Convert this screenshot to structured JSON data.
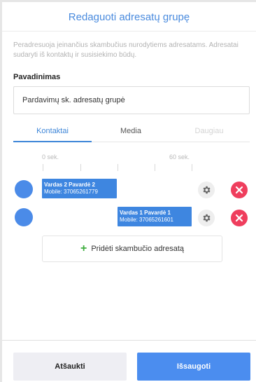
{
  "dialog": {
    "title": "Redaguoti adresatų grupę",
    "description": "Peradresuoja įeinančius skambučius nurodytiems adresatams. Adresatai sudaryti iš kontaktų ir susisiekimo būdų.",
    "name_label": "Pavadinimas",
    "name_value": "Pardavimų sk. adresatų grupė"
  },
  "tabs": [
    {
      "label": "Kontaktai",
      "active": true
    },
    {
      "label": "Media",
      "active": false
    },
    {
      "label": "Daugiau",
      "active": false,
      "disabled": true
    }
  ],
  "timeline": {
    "start_label": "0 sek.",
    "end_label": "60 sek."
  },
  "destinations": [
    {
      "name": "Vardas 2 Pavardė 2",
      "mobile": "Mobile: 37065261779",
      "settings_icon": "gear-icon",
      "remove_icon": "close-icon"
    },
    {
      "name": "Vardas 1 Pavardė 1",
      "mobile": "Mobile: 37065261601",
      "settings_icon": "gear-icon",
      "remove_icon": "close-icon"
    }
  ],
  "add_button": {
    "label": "Pridėti skambučio adresatą",
    "icon": "plus-icon"
  },
  "footer": {
    "cancel_label": "Atšaukti",
    "save_label": "Išsaugoti"
  },
  "colors": {
    "accent": "#3e86d8",
    "destination_bar": "#3e86e0",
    "delete": "#ef3e5d",
    "add_plus": "#3fae3f",
    "save_button": "#4b8def"
  }
}
